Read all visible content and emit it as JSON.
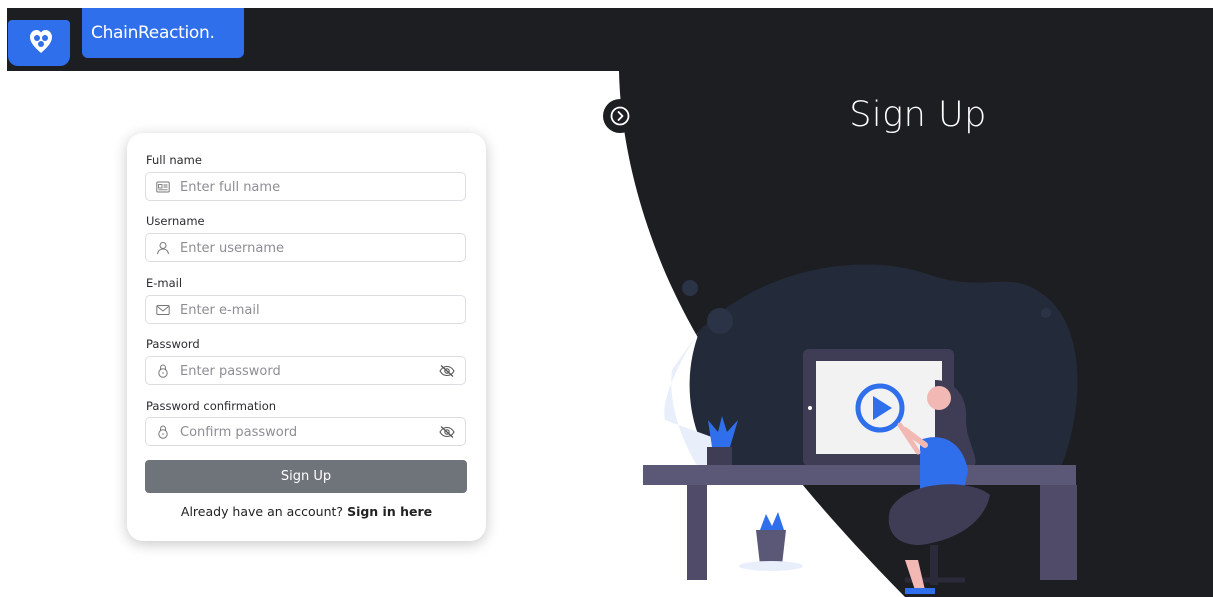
{
  "brand": {
    "name": "ChainReaction."
  },
  "panel": {
    "title": "Sign Up"
  },
  "form": {
    "fields": [
      {
        "label": "Full name",
        "placeholder": "Enter full name",
        "icon": "id-card-icon"
      },
      {
        "label": "Username",
        "placeholder": "Enter username",
        "icon": "user-icon"
      },
      {
        "label": "E-mail",
        "placeholder": "Enter e-mail",
        "icon": "mail-icon"
      },
      {
        "label": "Password",
        "placeholder": "Enter password",
        "icon": "lock-icon",
        "toggle": "eye-off-icon"
      },
      {
        "label": "Password confirmation",
        "placeholder": "Confirm password",
        "icon": "lock-icon",
        "toggle": "eye-off-icon"
      }
    ],
    "submit_label": "Sign Up",
    "signin_prompt": "Already have an account?",
    "signin_link": "Sign in here"
  },
  "colors": {
    "accent": "#2f6fec",
    "dark": "#1d1e22",
    "button": "#6f737a"
  }
}
